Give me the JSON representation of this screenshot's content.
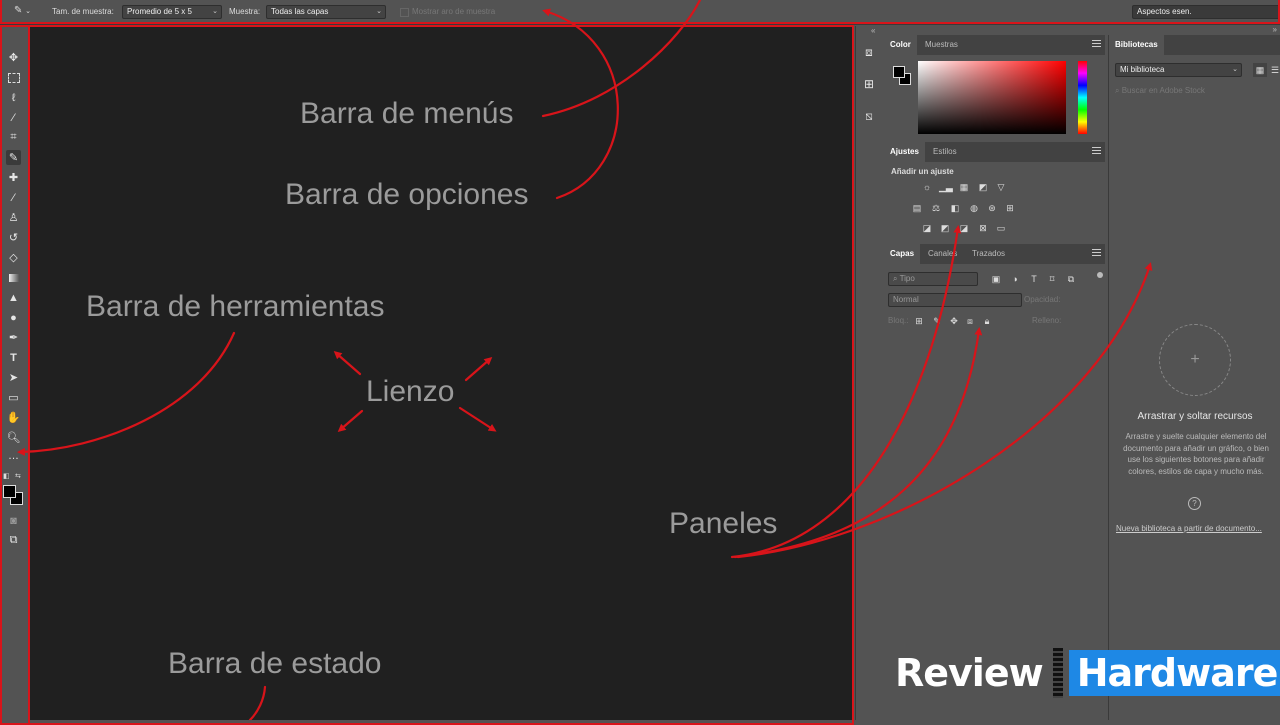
{
  "options_bar": {
    "sample_size_label": "Tam. de muestra:",
    "sample_size_value": "Promedio de 5 x 5",
    "sample_label": "Muestra:",
    "sample_value": "Todas las capas",
    "show_ring_label": "Mostrar aro de muestra",
    "workspace": "Aspectos esen."
  },
  "panels": {
    "color": {
      "tabs": [
        "Color",
        "Muestras"
      ]
    },
    "adjustments": {
      "tabs": [
        "Ajustes",
        "Estilos"
      ],
      "add_label": "Añadir un ajuste"
    },
    "layers": {
      "tabs": [
        "Capas",
        "Canales",
        "Trazados"
      ],
      "filter_placeholder": "Tipo",
      "blend_mode": "Normal",
      "opacity_label": "Opacidad:",
      "lock_label": "Bloq.:",
      "fill_label": "Relleno:"
    },
    "libraries": {
      "tab": "Bibliotecas",
      "library_select": "Mi biblioteca",
      "search_placeholder": "Buscar en Adobe Stock",
      "drag_title": "Arrastrar y soltar recursos",
      "drag_description": "Arrastre y suelte cualquier elemento del documento para añadir un gráfico, o bien use los siguientes botones para añadir colores, estilos de capa y mucho más.",
      "new_library_link": "Nueva biblioteca a partir de documento..."
    }
  },
  "annotations": {
    "menu_bar": "Barra de menús",
    "options_bar": "Barra de opciones",
    "toolbar": "Barra de herramientas",
    "canvas": "Lienzo",
    "panels": "Paneles",
    "status_bar": "Barra de estado"
  },
  "watermark": {
    "word1": "Review",
    "word2": "Hardware"
  },
  "colors": {
    "accent_red": "#d8141a",
    "watermark_blue": "#1e88e5",
    "canvas": "#202020",
    "ui_gray": "#535353"
  },
  "icons": {
    "tools": [
      "move-icon",
      "marquee-icon",
      "lasso-icon",
      "magic-wand-icon",
      "crop-icon",
      "eyedropper-icon",
      "healing-brush-icon",
      "brush-icon",
      "stamp-icon",
      "history-brush-icon",
      "eraser-icon",
      "gradient-icon",
      "blur-icon",
      "dodge-icon",
      "pen-icon",
      "type-icon",
      "path-select-icon",
      "shape-icon",
      "hand-icon",
      "zoom-icon",
      "more-tools-icon"
    ]
  }
}
